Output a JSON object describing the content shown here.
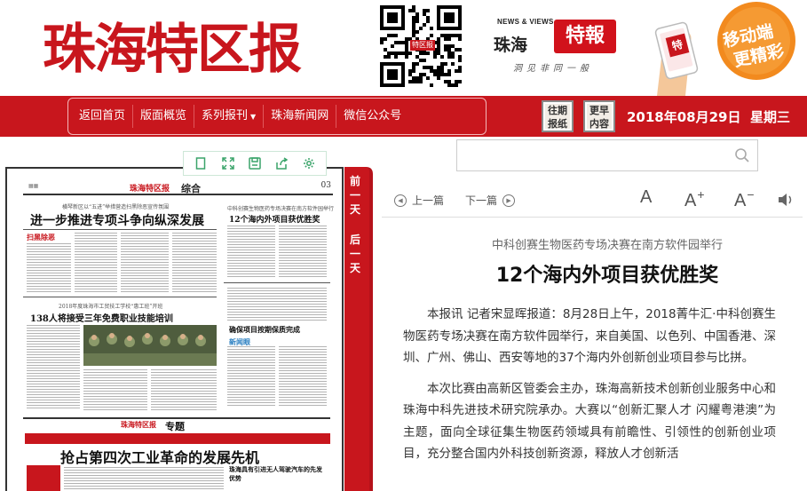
{
  "header": {
    "logo_text": "珠海特区报",
    "qr_label": "特区报",
    "brand_en": "NEWS & VIEWS",
    "brand_zh": "珠海",
    "brand_stamp": "特報",
    "brand_slogan": "洞见非同一般",
    "promo_badge": "特",
    "promo_text_1": "移动端",
    "promo_text_2": "更精彩"
  },
  "nav": {
    "items": [
      {
        "label": "返回首页"
      },
      {
        "label": "版面概览"
      },
      {
        "label": "系列报刊",
        "caret": "▼"
      },
      {
        "label": "珠海新闻网"
      },
      {
        "label": "微信公众号"
      }
    ],
    "past_btn": "往期报纸",
    "prev_btn": "更早内容",
    "past_btn_l1": "往期",
    "past_btn_l2": "报纸",
    "prev_btn_l1": "更早",
    "prev_btn_l2": "内容",
    "date": "2018年08月29日",
    "weekday": "星期三"
  },
  "search": {
    "value": "",
    "placeholder": ""
  },
  "toolbar": {
    "icons": [
      "page-icon",
      "fullscreen-icon",
      "save-icon",
      "share-icon",
      "settings-icon"
    ]
  },
  "newspaper": {
    "page_number": "03",
    "section": "综合",
    "masthead": "珠海特区报",
    "kicker1": "横琴新区以“五进”举措营造扫黑除恶宣传氛围",
    "headline1": "进一步推进专项斗争向纵深发展",
    "kicker2": "2018年度珠海市工贸技工学校“惠工班”开班",
    "headline2": "138人将接受三年免费职业技能培训",
    "kicker3": "中科创赛生物医药专场决赛在南方软件园举行",
    "headline3": "12个海内外项目获优胜奖",
    "headline4": "确保项目按期保质完成",
    "section2": "专题",
    "headline5": "抢占第四次工业革命的发展先机",
    "headline6": "珠海具有引进无人驾驶汽车的先发优势",
    "tag1": "扫黑除恶",
    "tag2": "新闻眼"
  },
  "ribbon": {
    "prev_label": [
      "前",
      "一",
      "天"
    ],
    "next_label": [
      "后",
      "一",
      "天"
    ]
  },
  "article_tools": {
    "prev": "上一篇",
    "next": "下一篇",
    "font_normal": "A",
    "font_bigger": "A",
    "font_bigger_sign": "+",
    "font_smaller": "A",
    "font_smaller_sign": "−"
  },
  "article": {
    "subtitle": "中科创赛生物医药专场决赛在南方软件园举行",
    "title": "12个海内外项目获优胜奖",
    "paragraphs": [
      "本报讯 记者宋显晖报道：8月28日上午，2018菁牛汇·中科创赛生物医药专场决赛在南方软件园举行，来自美国、以色列、中国香港、深圳、广州、佛山、西安等地的37个海内外创新创业项目参与比拼。",
      "本次比赛由高新区管委会主办，珠海高新技术创新创业服务中心和珠海中科先进技术研究院承办。大赛以“创新汇聚人才 闪耀粤港澳”为主题，面向全球征集生物医药领域具有前瞻性、引领性的创新创业项目，充分整合国内外科技创新资源，释放人才创新活"
    ]
  },
  "colors": {
    "brand_red": "#c8161d",
    "promo_orange": "#f28a1e"
  }
}
